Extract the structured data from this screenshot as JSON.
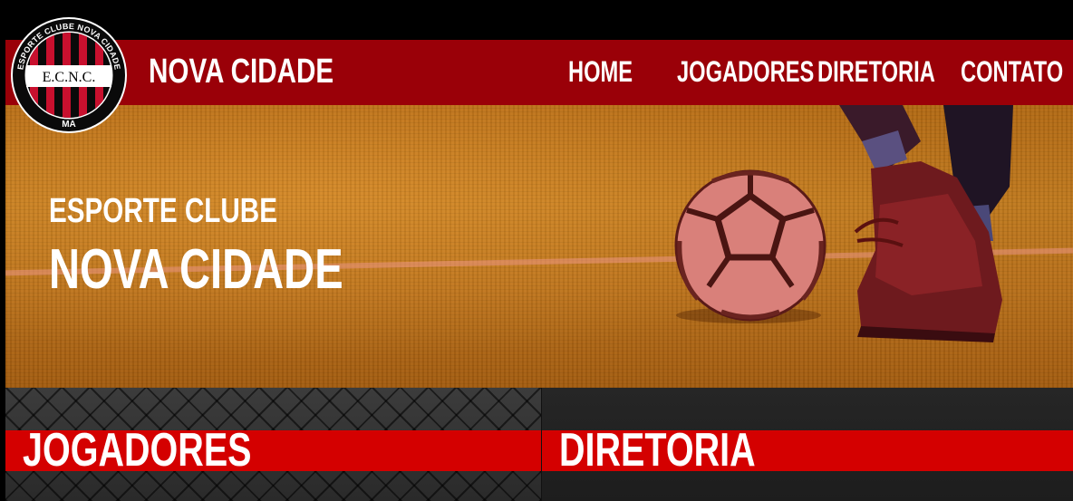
{
  "logo": {
    "ring_text": "ESPORTE CLUBE NOVA CIDADE",
    "initials": "E.C.N.C.",
    "bottom_text": "MA"
  },
  "navbar": {
    "brand": "NOVA CIDADE",
    "links": [
      "HOME",
      "JOGADORES",
      "DIRETORIA",
      "CONTATO"
    ]
  },
  "hero": {
    "eyebrow": "ESPORTE CLUBE",
    "title": "NOVA CIDADE"
  },
  "sections": [
    {
      "title": "JOGADORES"
    },
    {
      "title": "DIRETORIA"
    }
  ],
  "colors": {
    "navbar": "#9a0008",
    "section_band": "#d40000",
    "hero_tint": "#b8701a"
  }
}
